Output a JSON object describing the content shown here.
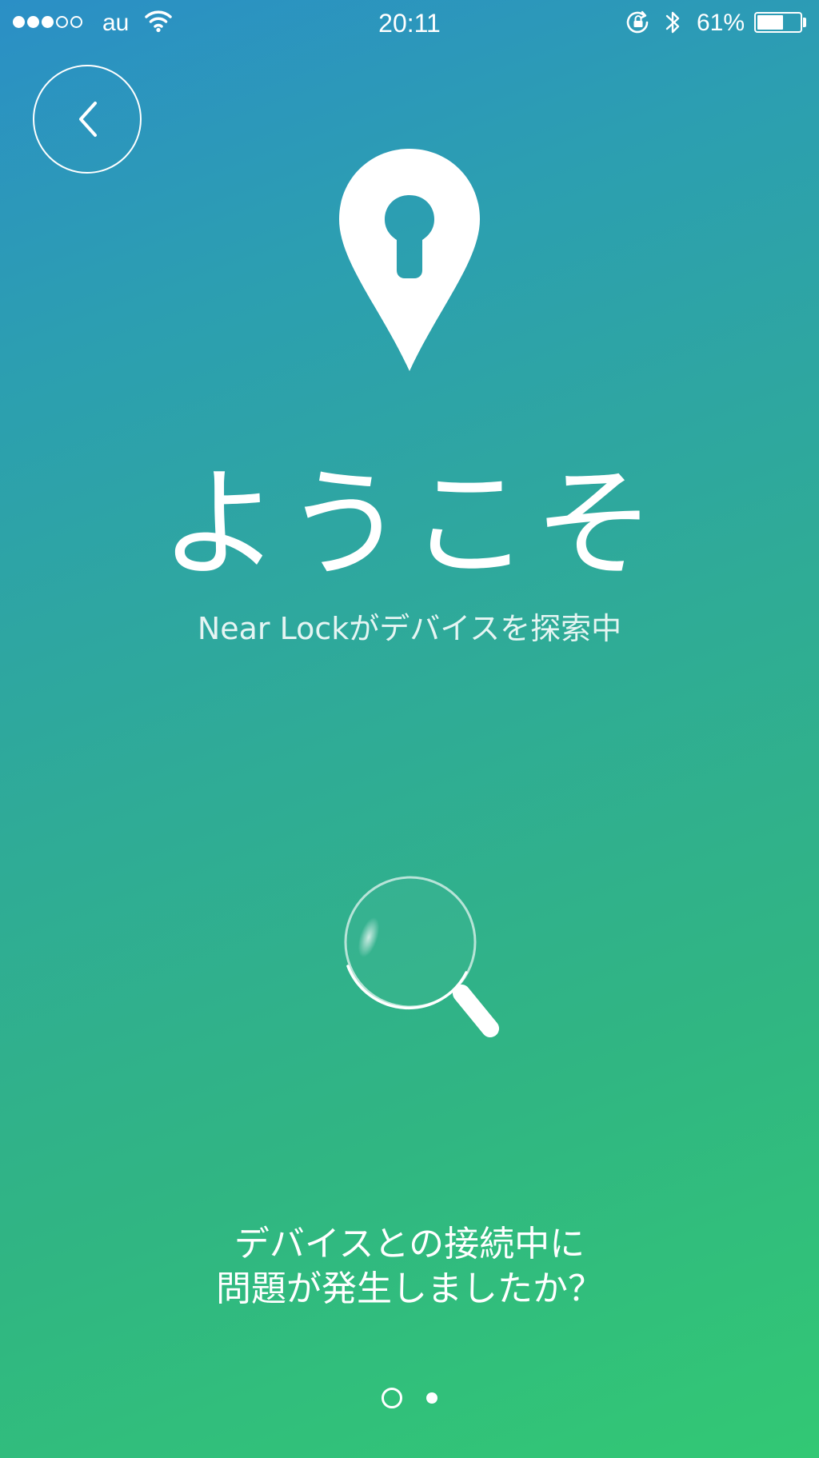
{
  "status_bar": {
    "signal_strength": 3,
    "signal_total": 5,
    "carrier": "au",
    "time": "20:11",
    "battery_percent": "61%",
    "battery_level": 0.61,
    "icons": [
      "signal-icon",
      "wifi-icon",
      "rotation-lock-icon",
      "bluetooth-icon",
      "battery-icon"
    ]
  },
  "header": {
    "back_icon": "chevron-left-icon"
  },
  "hero": {
    "icon": "location-pin-keyhole-icon",
    "title": "ようこそ",
    "subtitle": "Near Lockがデバイスを探索中"
  },
  "searching": {
    "icon": "search-icon"
  },
  "help": {
    "line1": "デバイスとの接続中に",
    "line2": "問題が発生しましたか？"
  },
  "pager": {
    "pages": 2,
    "current": 2
  },
  "colors": {
    "gradient_start": "#2b8fc6",
    "gradient_end": "#32c874",
    "foreground": "#ffffff"
  }
}
